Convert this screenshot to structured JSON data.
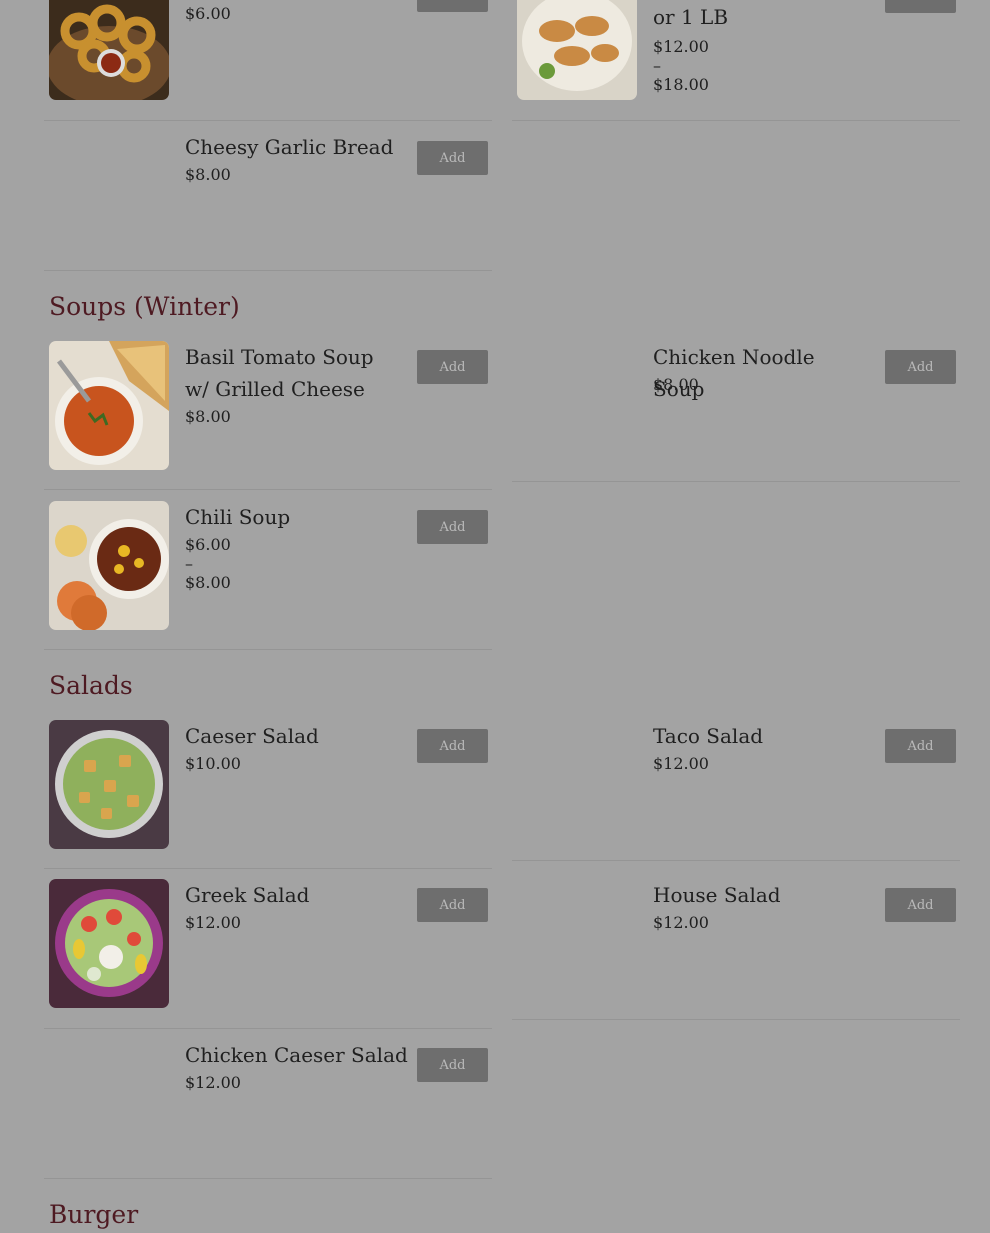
{
  "colors": {
    "background": "#a3a3a3",
    "category": "#4e1a22",
    "add_button": "#6e6e6e"
  },
  "categories": {
    "soups": "Soups (Winter)",
    "salads": "Salads",
    "burger": "Burger"
  },
  "items": {
    "onion_rings": {
      "price": "$6.00",
      "add": "Add"
    },
    "wings": {
      "name_tail": "or 1 LB",
      "price": "$12.00 – $18.00",
      "add": "Add"
    },
    "garlic_bread": {
      "name": "Cheesy Garlic Bread",
      "price": "$8.00",
      "add": "Add"
    },
    "basil_tomato": {
      "name": "Basil Tomato Soup w/ Grilled Cheese",
      "price": "$8.00",
      "add": "Add"
    },
    "chicken_noodle": {
      "name": "Chicken Noodle Soup",
      "price": "$8.00",
      "add": "Add"
    },
    "chili": {
      "name": "Chili Soup",
      "price": "$6.00 – $8.00",
      "add": "Add"
    },
    "caeser": {
      "name": "Caeser Salad",
      "price": "$10.00",
      "add": "Add"
    },
    "taco": {
      "name": "Taco Salad",
      "price": "$12.00",
      "add": "Add"
    },
    "greek": {
      "name": "Greek Salad",
      "price": "$12.00",
      "add": "Add"
    },
    "house": {
      "name": "House Salad",
      "price": "$12.00",
      "add": "Add"
    },
    "chicken_caeser": {
      "name": "Chicken Caeser Salad",
      "price": "$12.00",
      "add": "Add"
    }
  }
}
